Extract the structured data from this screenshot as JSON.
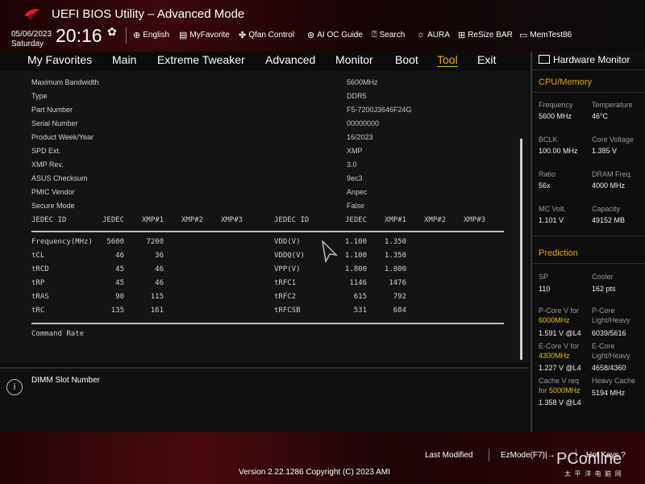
{
  "header": {
    "title": "UEFI BIOS Utility – Advanced Mode",
    "date": "05/06/2023",
    "day": "Saturday",
    "time": "20:16",
    "toolbar": {
      "english": "English",
      "myfavorite": "MyFavorite",
      "qfan": "Qfan Control",
      "aioc": "AI OC Guide",
      "search": "Search",
      "aura": "AURA",
      "resizebar": "ReSize BAR",
      "memtest": "MemTest86"
    }
  },
  "menu": {
    "items": [
      "My Favorites",
      "Main",
      "Extreme Tweaker",
      "Advanced",
      "Monitor",
      "Boot",
      "Tool",
      "Exit"
    ],
    "active": "Tool"
  },
  "spd": {
    "rows": [
      {
        "label": "Maximum Bandwidth",
        "value": "5600MHz"
      },
      {
        "label": "Type",
        "value": "DDR5"
      },
      {
        "label": "Part Number",
        "value": "F5-7200J3646F24G"
      },
      {
        "label": "Serial Number",
        "value": "00000000"
      },
      {
        "label": "Product Week/Year",
        "value": "16/2023"
      },
      {
        "label": "SPD Ext.",
        "value": "XMP"
      },
      {
        "label": "XMP Rev.",
        "value": "3.0"
      },
      {
        "label": "ASUS Checksum",
        "value": "9ec3"
      },
      {
        "label": "PMIC Vendor",
        "value": "Anpec"
      },
      {
        "label": "Secure Mode",
        "value": "False"
      }
    ]
  },
  "timing_table": {
    "headers_left": [
      "JEDEC ID",
      "JEDEC",
      "XMP#1",
      "XMP#2",
      "XMP#3"
    ],
    "headers_right": [
      "JEDEC ID",
      "JEDEC",
      "XMP#1",
      "XMP#2",
      "XMP#3"
    ],
    "left_rows": [
      [
        "Frequency(MHz)",
        "5600",
        "7200"
      ],
      [
        "tCL",
        "46",
        "36"
      ],
      [
        "tRCD",
        "45",
        "46"
      ],
      [
        "tRP",
        "45",
        "46"
      ],
      [
        "tRAS",
        "90",
        "115"
      ],
      [
        "tRC",
        "135",
        "161"
      ]
    ],
    "right_rows": [
      [
        "VDD(V)",
        "1.100",
        "1.350"
      ],
      [
        "VDDQ(V)",
        "1.100",
        "1.350"
      ],
      [
        "VPP(V)",
        "1.800",
        "1.800"
      ],
      [
        "tRFC1",
        "1146",
        "1476"
      ],
      [
        "tRFC2",
        "615",
        "792"
      ],
      [
        "tRFCSB",
        "531",
        "684"
      ]
    ],
    "command_rate": "Command Rate"
  },
  "help": {
    "text": "DIMM Slot Number"
  },
  "hw_monitor": {
    "title": "Hardware Monitor",
    "cpu_memory": {
      "title": "CPU/Memory",
      "frequency_label": "Frequency",
      "frequency": "5600 MHz",
      "temperature_label": "Temperature",
      "temperature": "46°C",
      "bclk_label": "BCLK",
      "bclk": "100.00 MHz",
      "core_voltage_label": "Core Voltage",
      "core_voltage": "1.385 V",
      "ratio_label": "Ratio",
      "ratio": "56x",
      "dram_freq_label": "DRAM Freq.",
      "dram_freq": "4000 MHz",
      "mc_volt_label": "MC Volt.",
      "mc_volt": "1.101 V",
      "capacity_label": "Capacity",
      "capacity": "49152 MB"
    },
    "prediction": {
      "title": "Prediction",
      "sp_label": "SP",
      "sp": "110",
      "cooler_label": "Cooler",
      "cooler": "162 pts",
      "pcore_v_label": "P-Core V for",
      "pcore_v_freq": "6000MHz",
      "pcore_v": "1.591 V @L4",
      "pcore_lh_label": "P-Core",
      "pcore_lh_label2": "Light/Heavy",
      "pcore_lh": "6039/5616",
      "ecore_v_label": "E-Core V for",
      "ecore_v_freq": "4300MHz",
      "ecore_v": "1.227 V @L4",
      "ecore_lh_label": "E-Core",
      "ecore_lh_label2": "Light/Heavy",
      "ecore_lh": "4658/4360",
      "cache_v_label": "Cache V req",
      "cache_v_for": "for",
      "cache_v_freq": "5000MHz",
      "cache_v": "1.358 V @L4",
      "heavy_cache_label": "Heavy Cache",
      "heavy_cache": "5194 MHz"
    }
  },
  "footer": {
    "last_modified": "Last Modified",
    "ezmode": "EzMode(F7)|→",
    "hotkeys": "Hot Keys",
    "version": "Version 2.22.1286 Copyright (C) 2023 AMI",
    "watermark": "PConline",
    "watermark_sub": "太 平 洋 电 脑 网"
  },
  "colors": {
    "accent": "#e8b300",
    "highlight_value": "#e8c200",
    "header_red": "#3b070b"
  }
}
